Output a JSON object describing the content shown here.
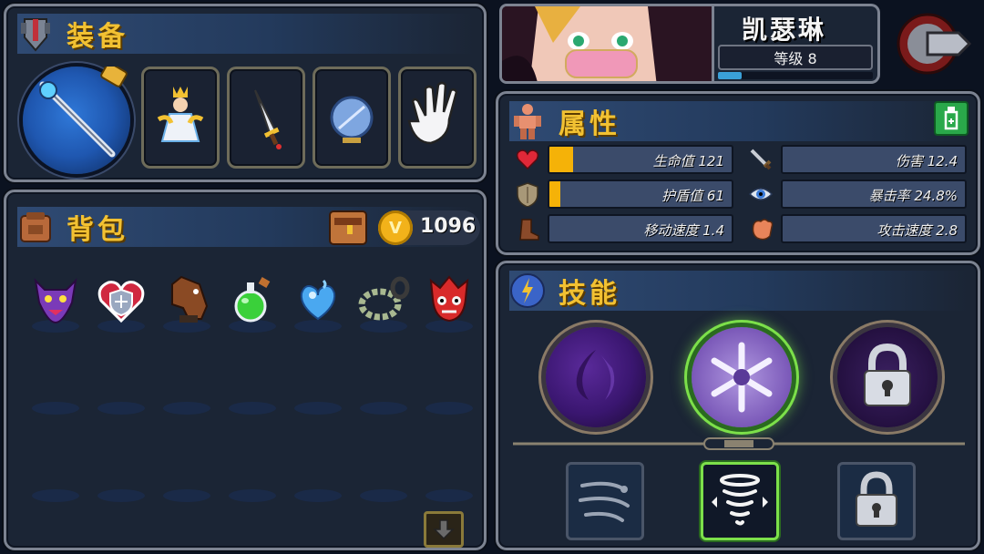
{
  "equipment": {
    "title": "装备",
    "slots": [
      "weapon-staff-icon",
      "figurine-icon",
      "dagger-icon",
      "crystal-orb-icon",
      "glove-icon"
    ]
  },
  "backpack": {
    "title": "背包",
    "coins": "1096",
    "items": [
      "demon-mask-icon",
      "heart-shield-icon",
      "horse-head-icon",
      "green-potion-icon",
      "blue-heart-icon",
      "chain-ring-icon",
      "red-mask-icon"
    ],
    "empty_rows": 2,
    "empty_cols": 7
  },
  "character": {
    "name": "凯瑟琳",
    "level_label": "等级 8",
    "exp": 0.15
  },
  "attributes": {
    "title": "属性",
    "stats": [
      {
        "label": "生命值 121",
        "fill": 0.13,
        "icon": "heart-icon",
        "color": "gold"
      },
      {
        "label": "伤害 12.4",
        "fill": 0.0,
        "icon": "sword-icon",
        "color": "blue"
      },
      {
        "label": "护盾值 61",
        "fill": 0.06,
        "icon": "shield-icon",
        "color": "gold"
      },
      {
        "label": "暴击率 24.8%",
        "fill": 0.0,
        "icon": "eye-icon",
        "color": "blue"
      },
      {
        "label": "移动速度 1.4",
        "fill": 0.0,
        "icon": "boot-icon",
        "color": "blue"
      },
      {
        "label": "攻击速度 2.8",
        "fill": 0.0,
        "icon": "fist-icon",
        "color": "blue"
      }
    ]
  },
  "skills": {
    "title": "技能",
    "orbs": [
      "dark-flame-skill-icon",
      "snowflake-skill-icon",
      "locked-skill-icon"
    ],
    "slots": [
      "wind-dash-skill-icon",
      "tornado-skill-icon",
      "locked-skill-icon"
    ],
    "selected_orb": 1,
    "selected_slot": 1
  },
  "colors": {
    "accent_gold": "#f2c132",
    "panel_bg": "#1b2535",
    "selected_green": "#7ce04a"
  }
}
